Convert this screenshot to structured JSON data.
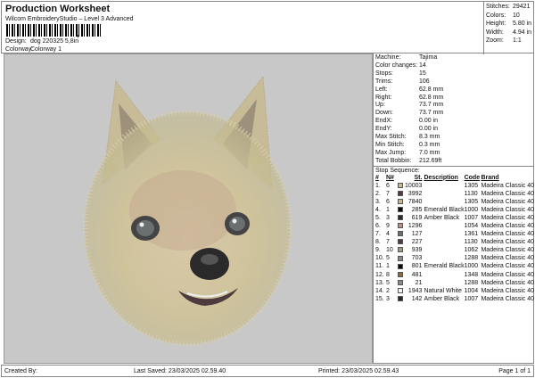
{
  "header": {
    "title": "Production Worksheet",
    "subtitle": "Wilcom EmbroideryStudio – Level 3 Advanced",
    "design_label": "Design:",
    "design": "dog 220325 5,8in",
    "colorway_label": "Colorway:",
    "colorway": "Colorway 1",
    "barcode_comma": ","
  },
  "stats": [
    {
      "k": "Stitches:",
      "v": "29421"
    },
    {
      "k": "Colors:",
      "v": "10"
    },
    {
      "k": "Height:",
      "v": "5.80 in"
    },
    {
      "k": "Width:",
      "v": "4.94 in"
    },
    {
      "k": "Zoom:",
      "v": "1:1"
    }
  ],
  "machine_info": [
    {
      "k": "Machine:",
      "v": "Tajima"
    },
    {
      "k": "Color changes:",
      "v": "14"
    },
    {
      "k": "Stops:",
      "v": "15"
    },
    {
      "k": "Trims:",
      "v": "106"
    },
    {
      "k": "Left:",
      "v": "62.8 mm"
    },
    {
      "k": "Right:",
      "v": "62.8 mm"
    },
    {
      "k": "Up:",
      "v": "73.7 mm"
    },
    {
      "k": "Down:",
      "v": "73.7 mm"
    },
    {
      "k": "EndX:",
      "v": "0.00 in"
    },
    {
      "k": "EndY:",
      "v": "0.00 in"
    },
    {
      "k": "Max Stitch:",
      "v": "8.3 mm"
    },
    {
      "k": "Min Stitch:",
      "v": "0.3 mm"
    },
    {
      "k": "Max Jump:",
      "v": "7.0 mm"
    },
    {
      "k": "Total Bobbin:",
      "v": "212.69ft"
    }
  ],
  "stop_sequence": {
    "title": "Stop Sequence:",
    "headers": [
      "#",
      "N#",
      "St.",
      "Description",
      "Code",
      "Brand"
    ],
    "rows": [
      {
        "n": "1.",
        "needle": "6",
        "color": "#c9b993",
        "st": "10003",
        "desc": "",
        "code": "1305",
        "brand": "Madeira Classic 40"
      },
      {
        "n": "2.",
        "needle": "7",
        "color": "#4d3b3d",
        "st": "3992",
        "desc": "",
        "code": "1130",
        "brand": "Madeira Classic 40"
      },
      {
        "n": "3.",
        "needle": "6",
        "color": "#c9b993",
        "st": "7840",
        "desc": "",
        "code": "1305",
        "brand": "Madeira Classic 40"
      },
      {
        "n": "4.",
        "needle": "1",
        "color": "#0a0a0a",
        "st": "285",
        "desc": "Emerald Black",
        "code": "1000",
        "brand": "Madeira Classic 40"
      },
      {
        "n": "5.",
        "needle": "3",
        "color": "#2a2a2a",
        "st": "619",
        "desc": "Amber Black",
        "code": "1007",
        "brand": "Madeira Classic 40"
      },
      {
        "n": "6.",
        "needle": "9",
        "color": "#b98f88",
        "st": "1296",
        "desc": "",
        "code": "1054",
        "brand": "Madeira Classic 40"
      },
      {
        "n": "7.",
        "needle": "4",
        "color": "#6e6e6e",
        "st": "127",
        "desc": "",
        "code": "1361",
        "brand": "Madeira Classic 40"
      },
      {
        "n": "8.",
        "needle": "7",
        "color": "#4d3b3d",
        "st": "227",
        "desc": "",
        "code": "1130",
        "brand": "Madeira Classic 40"
      },
      {
        "n": "9.",
        "needle": "10",
        "color": "#a19b88",
        "st": "939",
        "desc": "",
        "code": "1062",
        "brand": "Madeira Classic 40"
      },
      {
        "n": "10.",
        "needle": "5",
        "color": "#8a8a8a",
        "st": "703",
        "desc": "",
        "code": "1288",
        "brand": "Madeira Classic 40"
      },
      {
        "n": "11.",
        "needle": "1",
        "color": "#0a0a0a",
        "st": "801",
        "desc": "Emerald Black",
        "code": "1000",
        "brand": "Madeira Classic 40"
      },
      {
        "n": "12.",
        "needle": "8",
        "color": "#8b6a40",
        "st": "481",
        "desc": "",
        "code": "1348",
        "brand": "Madeira Classic 40"
      },
      {
        "n": "13.",
        "needle": "5",
        "color": "#8a8a8a",
        "st": "21",
        "desc": "",
        "code": "1288",
        "brand": "Madeira Classic 40"
      },
      {
        "n": "14.",
        "needle": "2",
        "color": "#f2f2f2",
        "st": "1943",
        "desc": "Natural White",
        "code": "1004",
        "brand": "Madeira Classic 40"
      },
      {
        "n": "15.",
        "needle": "3",
        "color": "#2a2a2a",
        "st": "142",
        "desc": "Amber Black",
        "code": "1007",
        "brand": "Madeira Classic 40"
      }
    ]
  },
  "footer": {
    "created": "Created By:",
    "saved": "Last Saved: 23/03/2025 02.59.40",
    "printed": "Printed: 23/03/2025 02.59.43",
    "page": "Page 1 of 1"
  }
}
